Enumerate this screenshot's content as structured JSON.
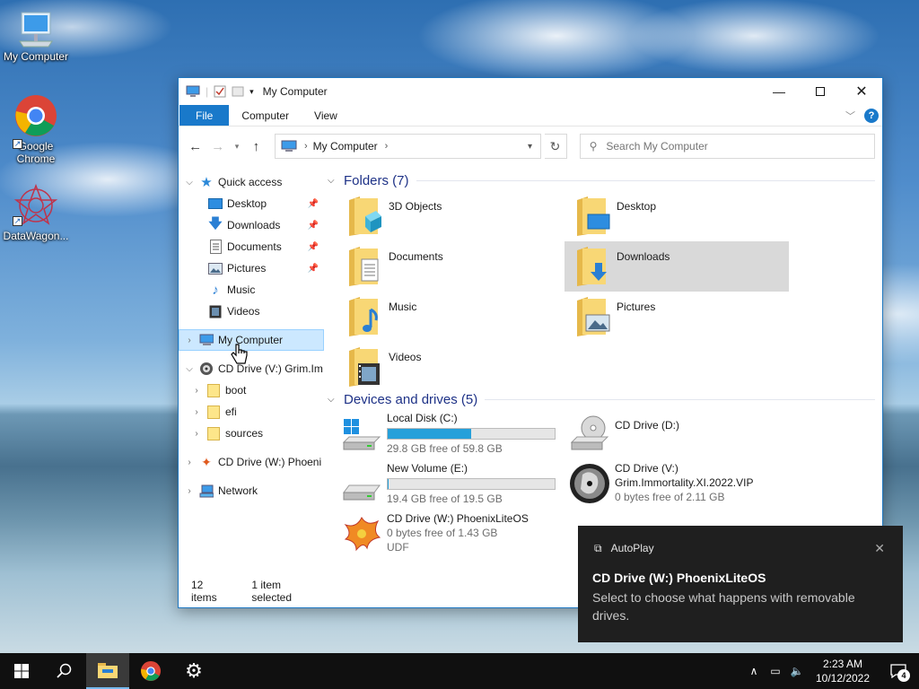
{
  "desktop": {
    "icons": [
      {
        "label": "My Computer"
      },
      {
        "label": "Google Chrome"
      },
      {
        "label": "DataWagon..."
      }
    ]
  },
  "window": {
    "title": "My Computer",
    "ribbon": {
      "file": "File",
      "computer": "Computer",
      "view": "View",
      "help": "?"
    },
    "address": {
      "crumb": "My Computer"
    },
    "search": {
      "placeholder": "Search My Computer"
    },
    "nav": {
      "quick_access": "Quick access",
      "quick_items": [
        "Desktop",
        "Downloads",
        "Documents",
        "Pictures",
        "Music",
        "Videos"
      ],
      "my_computer": "My Computer",
      "cd_v": "CD Drive (V:) Grim.Im",
      "cd_v_children": [
        "boot",
        "efi",
        "sources"
      ],
      "cd_w": "CD Drive (W:) Phoeni",
      "network": "Network"
    },
    "folders_header": "Folders (7)",
    "folders": [
      "3D Objects",
      "Desktop",
      "Documents",
      "Downloads",
      "Music",
      "Pictures",
      "Videos"
    ],
    "devices_header": "Devices and drives (5)",
    "drives": [
      {
        "name": "Local Disk (C:)",
        "free": "29.8 GB free of 59.8 GB",
        "used_fraction": 0.5
      },
      {
        "name": "CD Drive (D:)"
      },
      {
        "name": "New Volume (E:)",
        "free": "19.4 GB free of 19.5 GB",
        "used_fraction": 0.005
      },
      {
        "name": "CD Drive (V:)",
        "line2": "Grim.Immortality.XI.2022.VIP",
        "free": "0 bytes free of 2.11 GB"
      },
      {
        "name": "CD Drive (W:) PhoenixLiteOS",
        "free": "0 bytes free of 1.43 GB",
        "fs": "UDF"
      }
    ],
    "status": {
      "items": "12 items",
      "selected": "1 item selected"
    }
  },
  "toast": {
    "app": "AutoPlay",
    "title": "CD Drive (W:) PhoenixLiteOS",
    "message": "Select to choose what happens with removable drives."
  },
  "taskbar": {
    "time": "2:23 AM",
    "date": "10/12/2022",
    "notification_count": "4"
  },
  "colors": {
    "accent": "#1979ca",
    "selection": "#cce8ff",
    "progress": "#26a0da"
  }
}
